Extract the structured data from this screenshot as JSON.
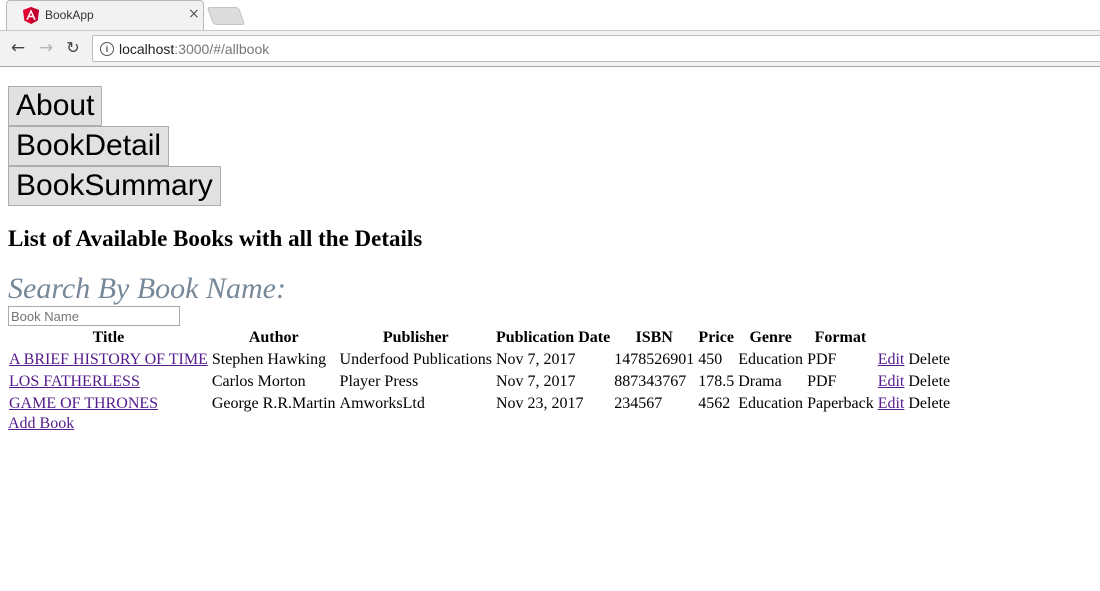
{
  "browser": {
    "tab_title": "BookApp",
    "close_glyph": "×",
    "url_host": "localhost",
    "url_rest": ":3000/#/allbook",
    "info_glyph": "i",
    "back_glyph": "←",
    "forward_glyph": "→",
    "reload_glyph": "↻",
    "accent": "#dd0031"
  },
  "nav": {
    "buttons": [
      "About",
      "BookDetail",
      "BookSummary"
    ]
  },
  "heading": "List of Available Books with all the Details",
  "search": {
    "label": "Search By Book Name:",
    "placeholder": "Book Name",
    "value": ""
  },
  "table": {
    "headers": [
      "Title",
      "Author",
      "Publisher",
      "Publication Date",
      "ISBN",
      "Price",
      "Genre",
      "Format",
      ""
    ],
    "rows": [
      {
        "title": "A BRIEF HISTORY OF TIME",
        "author": "Stephen Hawking",
        "publisher": "Underfood Publications",
        "date": "Nov 7, 2017",
        "isbn": "1478526901",
        "price": "450",
        "genre": "Education",
        "format": "PDF",
        "edit": "Edit",
        "delete": "Delete"
      },
      {
        "title": "LOS FATHERLESS",
        "author": "Carlos Morton",
        "publisher": "Player Press",
        "date": "Nov 7, 2017",
        "isbn": "887343767",
        "price": "178.5",
        "genre": "Drama",
        "format": "PDF",
        "edit": "Edit",
        "delete": "Delete"
      },
      {
        "title": "GAME OF THRONES",
        "author": "George R.R.Martin",
        "publisher": "AmworksLtd",
        "date": "Nov 23, 2017",
        "isbn": "234567",
        "price": "4562",
        "genre": "Education",
        "format": "Paperback",
        "edit": "Edit",
        "delete": "Delete"
      }
    ]
  },
  "add_book": "Add Book"
}
